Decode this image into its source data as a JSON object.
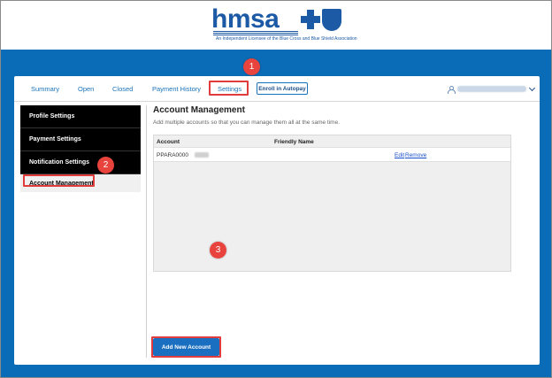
{
  "header": {
    "brand": "hmsa",
    "tagline": "An Independent Licensee of the Blue Cross and Blue Shield Association"
  },
  "nav": {
    "tabs": [
      {
        "label": "Summary"
      },
      {
        "label": "Open"
      },
      {
        "label": "Closed"
      },
      {
        "label": "Payment History"
      },
      {
        "label": "Settings",
        "active": true
      }
    ],
    "enroll_label": "Enroll in Autopay"
  },
  "sidebar": {
    "items": [
      {
        "label": "Profile Settings"
      },
      {
        "label": "Payment Settings"
      },
      {
        "label": "Notification Settings"
      },
      {
        "label": "Account Management",
        "active": true
      }
    ]
  },
  "main": {
    "title": "Account Management",
    "subtitle": "Add multiple accounts so that you can manage them all at the same time.",
    "table": {
      "headers": [
        "Account",
        "Friendly Name"
      ],
      "rows": [
        {
          "account": "PPARA0000",
          "friendly_name": "",
          "edit_label": "Edit",
          "remove_label": "Remove"
        }
      ]
    },
    "add_button_label": "Add New Account"
  },
  "callouts": [
    "1",
    "2",
    "3"
  ],
  "colors": {
    "brand_blue": "#1c5aa6",
    "page_blue": "#0a6cb6",
    "highlight_red": "#e03c3c",
    "badge_red": "#e8443d"
  }
}
